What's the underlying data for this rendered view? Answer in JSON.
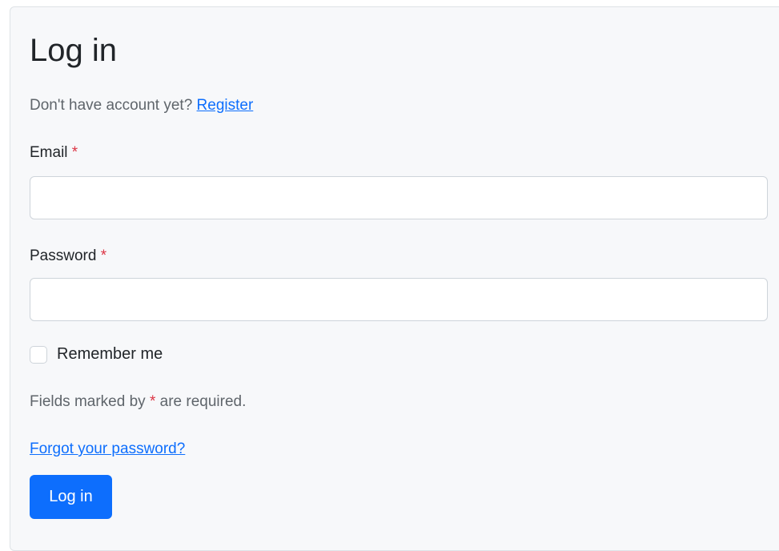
{
  "form": {
    "title": "Log in",
    "subtitle_text": "Don't have account yet?",
    "register_link": "Register",
    "email_label": "Email",
    "password_label": "Password",
    "required_marker": "*",
    "remember_label": "Remember me",
    "remember_checked": false,
    "hint_prefix": "Fields marked by",
    "hint_suffix": "are required.",
    "forgot_link": "Forgot your password?",
    "submit_label": "Log in"
  },
  "colors": {
    "accent": "#0d6efd",
    "required": "#dc3545",
    "card_background": "#f7f8fa",
    "muted_text": "#5f656b"
  }
}
